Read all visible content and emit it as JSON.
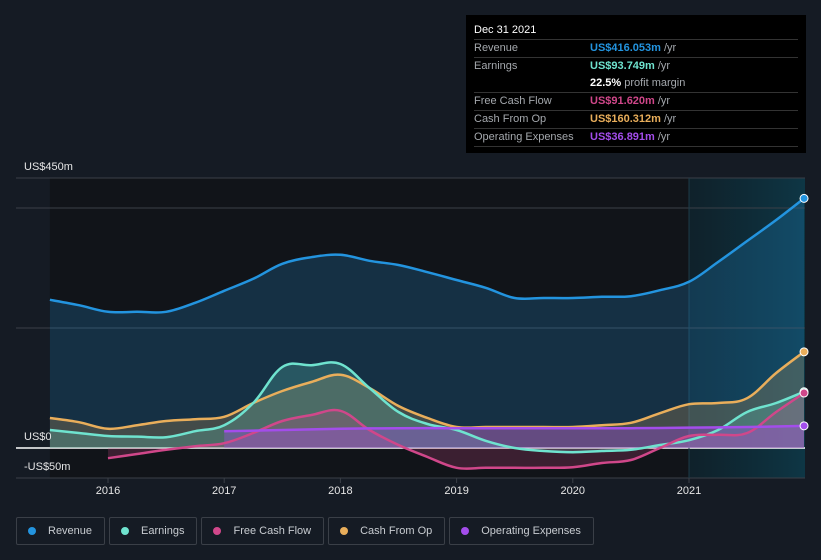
{
  "tooltip": {
    "date": "Dec 31 2021",
    "rows": [
      {
        "label": "Revenue",
        "value": "US$416.053m",
        "unit": "/yr",
        "color": "#2394df"
      },
      {
        "label": "Earnings",
        "value": "US$93.749m",
        "unit": "/yr",
        "color": "#6fe3cf"
      },
      {
        "label": "",
        "value": "22.5%",
        "unit": "profit margin",
        "color": "#ffffff"
      },
      {
        "label": "Free Cash Flow",
        "value": "US$91.620m",
        "unit": "/yr",
        "color": "#d0478a"
      },
      {
        "label": "Cash From Op",
        "value": "US$160.312m",
        "unit": "/yr",
        "color": "#e9ae5b"
      },
      {
        "label": "Operating Expenses",
        "value": "US$36.891m",
        "unit": "/yr",
        "color": "#a34deb"
      }
    ]
  },
  "legend": [
    {
      "label": "Revenue",
      "color": "#2394df"
    },
    {
      "label": "Earnings",
      "color": "#6fe3cf"
    },
    {
      "label": "Free Cash Flow",
      "color": "#d0478a"
    },
    {
      "label": "Cash From Op",
      "color": "#e9ae5b"
    },
    {
      "label": "Operating Expenses",
      "color": "#a34deb"
    }
  ],
  "chart_data": {
    "type": "area",
    "title": "",
    "xlabel": "",
    "ylabel": "",
    "ylim": [
      -50,
      450
    ],
    "xlim": [
      2015.25,
      2022.0
    ],
    "x_ticks": [
      2016,
      2017,
      2018,
      2019,
      2020,
      2021
    ],
    "x_tick_labels": [
      "2016",
      "2017",
      "2018",
      "2019",
      "2020",
      "2021"
    ],
    "y_tick_labels": [
      {
        "value": 450,
        "label": "US$450m"
      },
      {
        "value": 0,
        "label": "US$0"
      },
      {
        "value": -50,
        "label": "-US$50m"
      }
    ],
    "gridlines_y": [
      450,
      400,
      200,
      0,
      -50
    ],
    "highlight_from": 2021.0,
    "series": [
      {
        "name": "Revenue",
        "color": "#2394df",
        "points": [
          [
            2015.5,
            247
          ],
          [
            2015.75,
            238
          ],
          [
            2016.0,
            227
          ],
          [
            2016.25,
            227
          ],
          [
            2016.5,
            227
          ],
          [
            2016.75,
            242
          ],
          [
            2017.0,
            262
          ],
          [
            2017.25,
            282
          ],
          [
            2017.5,
            307
          ],
          [
            2017.75,
            318
          ],
          [
            2018.0,
            322
          ],
          [
            2018.25,
            312
          ],
          [
            2018.5,
            305
          ],
          [
            2018.75,
            293
          ],
          [
            2019.0,
            280
          ],
          [
            2019.25,
            267
          ],
          [
            2019.5,
            250
          ],
          [
            2019.75,
            250
          ],
          [
            2020.0,
            250
          ],
          [
            2020.25,
            252
          ],
          [
            2020.5,
            253
          ],
          [
            2020.75,
            263
          ],
          [
            2021.0,
            277
          ],
          [
            2021.25,
            310
          ],
          [
            2021.5,
            345
          ],
          [
            2021.75,
            380
          ],
          [
            2021.99,
            416.05
          ]
        ]
      },
      {
        "name": "Earnings",
        "color": "#6fe3cf",
        "points": [
          [
            2015.5,
            30
          ],
          [
            2015.75,
            25
          ],
          [
            2016.0,
            20
          ],
          [
            2016.25,
            19
          ],
          [
            2016.5,
            18
          ],
          [
            2016.75,
            28
          ],
          [
            2017.0,
            38
          ],
          [
            2017.25,
            75
          ],
          [
            2017.5,
            135
          ],
          [
            2017.75,
            138
          ],
          [
            2018.0,
            140
          ],
          [
            2018.25,
            100
          ],
          [
            2018.5,
            60
          ],
          [
            2018.75,
            40
          ],
          [
            2019.0,
            30
          ],
          [
            2019.25,
            12
          ],
          [
            2019.5,
            0
          ],
          [
            2019.75,
            -5
          ],
          [
            2020.0,
            -7
          ],
          [
            2020.25,
            -5
          ],
          [
            2020.5,
            -3
          ],
          [
            2020.75,
            5
          ],
          [
            2021.0,
            13
          ],
          [
            2021.25,
            30
          ],
          [
            2021.5,
            60
          ],
          [
            2021.75,
            75
          ],
          [
            2021.99,
            93.75
          ]
        ]
      },
      {
        "name": "Free Cash Flow",
        "color": "#d0478a",
        "points": [
          [
            2016.0,
            -17
          ],
          [
            2016.25,
            -10
          ],
          [
            2016.5,
            -3
          ],
          [
            2016.75,
            3
          ],
          [
            2017.0,
            8
          ],
          [
            2017.25,
            25
          ],
          [
            2017.5,
            45
          ],
          [
            2017.75,
            55
          ],
          [
            2018.0,
            62
          ],
          [
            2018.25,
            30
          ],
          [
            2018.5,
            5
          ],
          [
            2018.75,
            -15
          ],
          [
            2019.0,
            -33
          ],
          [
            2019.25,
            -33
          ],
          [
            2019.5,
            -33
          ],
          [
            2019.75,
            -33
          ],
          [
            2020.0,
            -32
          ],
          [
            2020.25,
            -25
          ],
          [
            2020.5,
            -20
          ],
          [
            2020.75,
            0
          ],
          [
            2021.0,
            20
          ],
          [
            2021.25,
            22
          ],
          [
            2021.5,
            25
          ],
          [
            2021.75,
            60
          ],
          [
            2021.99,
            91.62
          ]
        ]
      },
      {
        "name": "Cash From Op",
        "color": "#e9ae5b",
        "points": [
          [
            2015.5,
            50
          ],
          [
            2015.75,
            43
          ],
          [
            2016.0,
            32
          ],
          [
            2016.25,
            38
          ],
          [
            2016.5,
            45
          ],
          [
            2016.75,
            48
          ],
          [
            2017.0,
            52
          ],
          [
            2017.25,
            75
          ],
          [
            2017.5,
            95
          ],
          [
            2017.75,
            110
          ],
          [
            2018.0,
            122
          ],
          [
            2018.25,
            100
          ],
          [
            2018.5,
            70
          ],
          [
            2018.75,
            50
          ],
          [
            2019.0,
            35
          ],
          [
            2019.25,
            35
          ],
          [
            2019.5,
            35
          ],
          [
            2019.75,
            35
          ],
          [
            2020.0,
            35
          ],
          [
            2020.25,
            38
          ],
          [
            2020.5,
            42
          ],
          [
            2020.75,
            58
          ],
          [
            2021.0,
            73
          ],
          [
            2021.25,
            75
          ],
          [
            2021.5,
            83
          ],
          [
            2021.75,
            125
          ],
          [
            2021.99,
            160.31
          ]
        ]
      },
      {
        "name": "Operating Expenses",
        "color": "#a34deb",
        "points": [
          [
            2017.0,
            28
          ],
          [
            2017.5,
            30
          ],
          [
            2018.0,
            32
          ],
          [
            2018.5,
            33
          ],
          [
            2019.0,
            33
          ],
          [
            2019.5,
            33
          ],
          [
            2020.0,
            33
          ],
          [
            2020.5,
            33
          ],
          [
            2021.0,
            34
          ],
          [
            2021.5,
            35
          ],
          [
            2021.99,
            36.89
          ]
        ]
      }
    ]
  }
}
